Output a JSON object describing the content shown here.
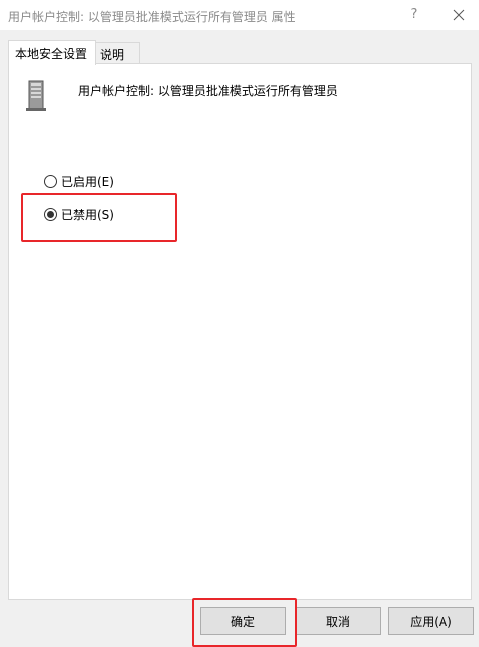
{
  "window": {
    "title": "用户帐户控制: 以管理员批准模式运行所有管理员 属性",
    "help_label": "?",
    "close_icon": "close-icon"
  },
  "tabs": [
    {
      "label": "本地安全设置",
      "active": true
    },
    {
      "label": "说明",
      "active": false
    }
  ],
  "policy": {
    "icon": "server-tower-icon",
    "title": "用户帐户控制: 以管理员批准模式运行所有管理员"
  },
  "options": [
    {
      "label": "已启用(E)",
      "selected": false
    },
    {
      "label": "已禁用(S)",
      "selected": true
    }
  ],
  "buttons": {
    "ok": "确定",
    "cancel": "取消",
    "apply": "应用(A)"
  },
  "colors": {
    "highlight": "#e8262a",
    "title_text": "#8a8a8a",
    "panel_bg": "#ffffff",
    "dialog_bg": "#f0f0f0"
  }
}
